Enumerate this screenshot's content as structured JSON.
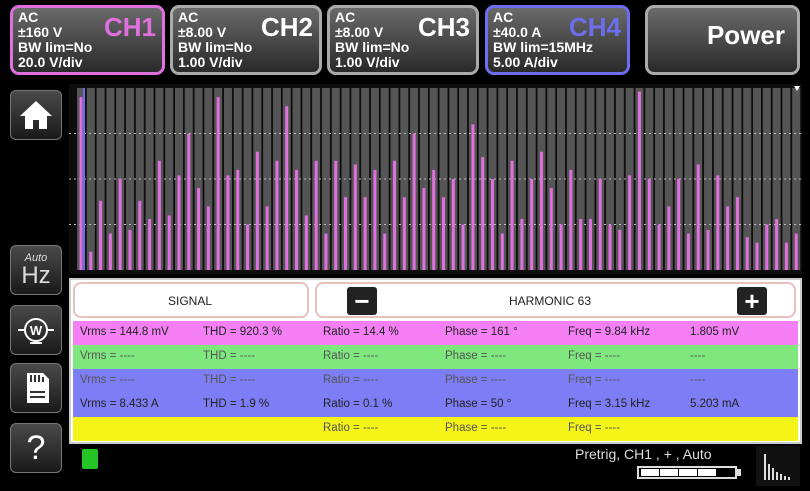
{
  "channels": [
    {
      "id": "ch1",
      "coupling": "AC",
      "range": "±160 V",
      "bw": "BW lim=No",
      "scale": "20.0 V/div",
      "name": "CH1",
      "color": "#e070e0"
    },
    {
      "id": "ch2",
      "coupling": "AC",
      "range": "±8.00 V",
      "bw": "BW lim=No",
      "scale": "1.00 V/div",
      "name": "CH2"
    },
    {
      "id": "ch3",
      "coupling": "AC",
      "range": "±8.00 V",
      "bw": "BW lim=No",
      "scale": "1.00 V/div",
      "name": "CH3"
    },
    {
      "id": "ch4",
      "coupling": "AC",
      "range": "±40.0 A",
      "bw": "BW lim=15MHz",
      "scale": "5.00 A/div",
      "name": "CH4",
      "color": "#6d6df0"
    }
  ],
  "power_label": "Power",
  "sidebar": {
    "hz_auto": "Auto",
    "hz_label": "Hz",
    "help": "?"
  },
  "header": {
    "signal": "SIGNAL",
    "harmonic": "HARMONIC 63",
    "minus": "−",
    "plus": "+"
  },
  "rows": [
    {
      "vrms": "Vrms = 144.8 mV",
      "thd": "THD = 920.3 %",
      "ratio": "Ratio = 14.4 %",
      "phase": "Phase = 161 °",
      "freq": "Freq = 9.84 kHz",
      "value": "1.805 mV",
      "color": "#f57ff5"
    },
    {
      "vrms": "Vrms = ----",
      "thd": "THD = ----",
      "ratio": "Ratio = ----",
      "phase": "Phase = ----",
      "freq": "Freq = ----",
      "value": "----",
      "color": "#7ee87e"
    },
    {
      "vrms": "Vrms = ----",
      "thd": "THD = ----",
      "ratio": "Ratio = ----",
      "phase": "Phase = ----",
      "freq": "Freq = ----",
      "value": "----",
      "color": "#7d7df5"
    },
    {
      "vrms": "Vrms = 8.433 A",
      "thd": "THD = 1.9 %",
      "ratio": "Ratio = 0.1 %",
      "phase": "Phase = 50 °",
      "freq": "Freq = 3.15 kHz",
      "value": "5.203 mA",
      "color": "#7d7df5"
    },
    {
      "vrms": "",
      "thd": "",
      "ratio": "Ratio = ----",
      "phase": "Phase = ----",
      "freq": "Freq = ----",
      "value": "",
      "color": "#f4f418"
    }
  ],
  "status": {
    "trigger": "Pretrig, CH1 , + , Auto",
    "battery_level": 0.8
  },
  "chart_data": {
    "type": "bar",
    "series": [
      {
        "color": "#e070e0",
        "values": [
          0.95,
          0.1,
          0.38,
          0.2,
          0.5,
          0.22,
          0.38,
          0.28,
          0.6,
          0.3,
          0.52,
          0.75,
          0.45,
          0.35,
          0.95,
          0.52,
          0.55,
          0.25,
          0.65,
          0.35,
          0.6,
          0.9,
          0.55,
          0.3,
          0.6,
          0.2,
          0.6,
          0.4,
          0.58,
          0.4,
          0.55,
          0.2,
          0.6,
          0.4,
          0.75,
          0.45,
          0.55,
          0.4,
          0.5,
          0.25,
          0.8,
          0.62,
          0.5,
          0.2,
          0.6,
          0.28,
          0.5,
          0.65,
          0.45,
          0.25,
          0.55,
          0.28,
          0.28,
          0.5,
          0.25,
          0.22,
          0.52,
          0.98,
          0.5,
          0.25,
          0.35,
          0.5,
          0.2,
          0.58,
          0.22,
          0.52,
          0.35,
          0.4,
          0.18,
          0.15,
          0.25,
          0.28,
          0.15,
          0.2
        ]
      }
    ],
    "ylim": [
      0,
      1
    ],
    "grid": true
  }
}
